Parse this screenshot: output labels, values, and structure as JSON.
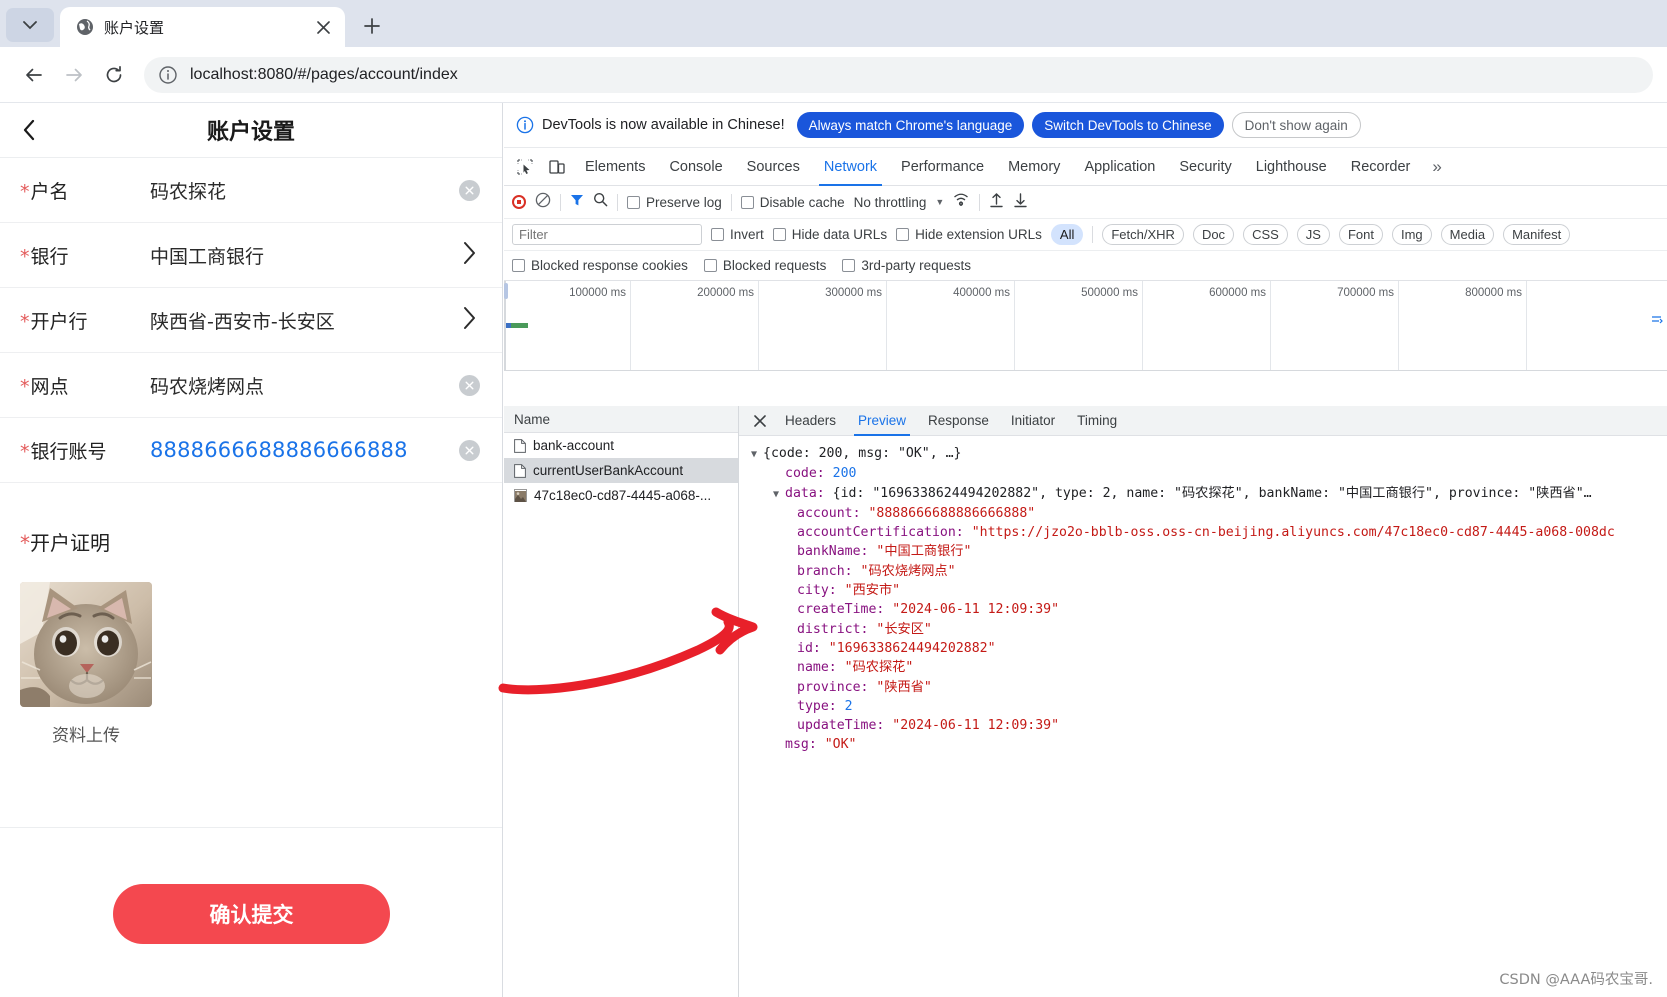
{
  "browser": {
    "tab_title": "账户设置",
    "favicon": "globe-icon",
    "url": "localhost:8080/#/pages/account/index",
    "newtab_label": "+"
  },
  "page": {
    "title": "账户设置",
    "back_icon": "chevron-left-icon",
    "fields": [
      {
        "required": "*",
        "label": "户名",
        "value": "码农探花",
        "action": "clear"
      },
      {
        "required": "*",
        "label": "银行",
        "value": "中国工商银行",
        "action": "chevron"
      },
      {
        "required": "*",
        "label": "开户行",
        "value": "陕西省-西安市-长安区",
        "action": "chevron"
      },
      {
        "required": "*",
        "label": "网点",
        "value": "码农烧烤网点",
        "action": "clear"
      },
      {
        "required": "*",
        "label": "银行账号",
        "value": "8888666688886666888",
        "action": "clear"
      }
    ],
    "upload": {
      "required": "*",
      "label": "开户证明",
      "caption": "资料上传",
      "thumb_alt": "kitten-photo"
    },
    "submit_label": "确认提交"
  },
  "devtools": {
    "banner": {
      "icon": "info-icon",
      "message": "DevTools is now available in Chinese!",
      "btn_always": "Always match Chrome's language",
      "btn_switch": "Switch DevTools to Chinese",
      "btn_dismiss": "Don't show again"
    },
    "tabs": [
      "Elements",
      "Console",
      "Sources",
      "Network",
      "Performance",
      "Memory",
      "Application",
      "Security",
      "Lighthouse",
      "Recorder"
    ],
    "active_tab": "Network",
    "more_tabs": "»",
    "network_toolbar": {
      "record_icon": "record-icon",
      "clear_icon": "clear-icon",
      "filter_icon": "funnel-icon",
      "search_icon": "search-icon",
      "preserve_log": "Preserve log",
      "disable_cache": "Disable cache",
      "throttling": "No throttling",
      "wifi_icon": "wifi-settings-icon",
      "import_icon": "import-har-icon",
      "export_icon": "export-har-icon"
    },
    "filter_bar": {
      "filter_placeholder": "Filter",
      "filter_value": "",
      "invert": "Invert",
      "hide_data_urls": "Hide data URLs",
      "hide_extension_urls": "Hide extension URLs",
      "types": [
        "All",
        "Fetch/XHR",
        "Doc",
        "CSS",
        "JS",
        "Font",
        "Img",
        "Media",
        "Manifest"
      ],
      "active_type": "All"
    },
    "filter_bar2": {
      "blocked_response_cookies": "Blocked response cookies",
      "blocked_requests": "Blocked requests",
      "third_party_requests": "3rd-party requests"
    },
    "timeline": {
      "ticks": [
        "100000 ms",
        "200000 ms",
        "300000 ms",
        "400000 ms",
        "500000 ms",
        "600000 ms",
        "700000 ms",
        "800000 ms"
      ]
    },
    "request_list": {
      "header": "Name",
      "rows": [
        {
          "name": "bank-account",
          "icon": "doc-icon",
          "selected": false
        },
        {
          "name": "currentUserBankAccount",
          "icon": "doc-icon",
          "selected": true
        },
        {
          "name": "47c18ec0-cd87-4445-a068-...",
          "icon": "image-icon",
          "selected": false
        }
      ]
    },
    "detail_tabs": [
      "Headers",
      "Preview",
      "Response",
      "Initiator",
      "Timing"
    ],
    "detail_active": "Preview",
    "close_icon": "close-icon",
    "preview": {
      "root_summary": "{code: 200, msg: \"OK\", …}",
      "code_key": "code:",
      "code_value": "200",
      "data_key": "data:",
      "data_summary": "{id: \"1696338624494202882\", type: 2, name: \"码农探花\", bankName: \"中国工商银行\", province: \"陕西省\"…",
      "entries": [
        {
          "key": "account:",
          "value": "\"8888666688886666888\"",
          "kind": "string"
        },
        {
          "key": "accountCertification:",
          "value": "\"https://jzo2o-bblb-oss.oss-cn-beijing.aliyuncs.com/47c18ec0-cd87-4445-a068-008dc",
          "kind": "string"
        },
        {
          "key": "bankName:",
          "value": "\"中国工商银行\"",
          "kind": "string"
        },
        {
          "key": "branch:",
          "value": "\"码农烧烤网点\"",
          "kind": "string"
        },
        {
          "key": "city:",
          "value": "\"西安市\"",
          "kind": "string"
        },
        {
          "key": "createTime:",
          "value": "\"2024-06-11 12:09:39\"",
          "kind": "string"
        },
        {
          "key": "district:",
          "value": "\"长安区\"",
          "kind": "string"
        },
        {
          "key": "id:",
          "value": "\"1696338624494202882\"",
          "kind": "string"
        },
        {
          "key": "name:",
          "value": "\"码农探花\"",
          "kind": "string"
        },
        {
          "key": "province:",
          "value": "\"陕西省\"",
          "kind": "string"
        },
        {
          "key": "type:",
          "value": "2",
          "kind": "number"
        },
        {
          "key": "updateTime:",
          "value": "\"2024-06-11 12:09:39\"",
          "kind": "string"
        }
      ],
      "msg_key": "msg:",
      "msg_value": "\"OK\""
    }
  },
  "annotation": {
    "arrow": "red-arrow-pointing-to-name-field"
  },
  "watermark": "CSDN @AAA码农宝哥.",
  "colors": {
    "accent_blue": "#1a73e8",
    "banner_blue": "#1a56db",
    "submit_red": "#f4484f",
    "required_red": "#e35b5b",
    "json_string": "#c41a16",
    "json_key": "#881280",
    "arrow_red": "#e8202a"
  }
}
